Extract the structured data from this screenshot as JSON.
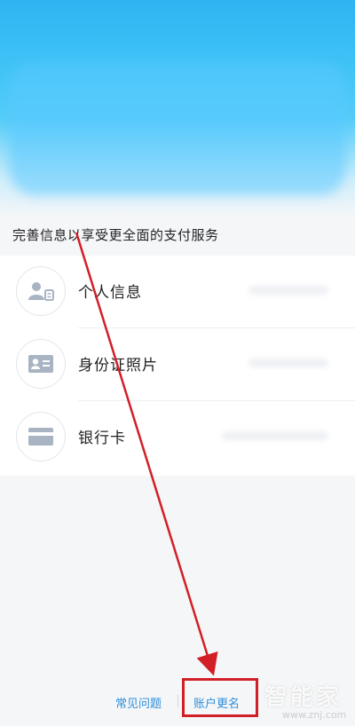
{
  "subtitle": "完善信息以享受更全面的支付服务",
  "items": [
    {
      "label": "个人信息",
      "icon": "person-card-icon"
    },
    {
      "label": "身份证照片",
      "icon": "id-card-icon"
    },
    {
      "label": "银行卡",
      "icon": "bank-card-icon"
    }
  ],
  "footer": {
    "faq_label": "常见问题",
    "rename_label": "账户更名"
  },
  "watermark": {
    "title": "智能家",
    "url": "www.znj.com"
  },
  "colors": {
    "header": "#3ec2f6",
    "link": "#2e8fd8",
    "highlight": "#d21f26",
    "icon": "#a9b4c2"
  }
}
